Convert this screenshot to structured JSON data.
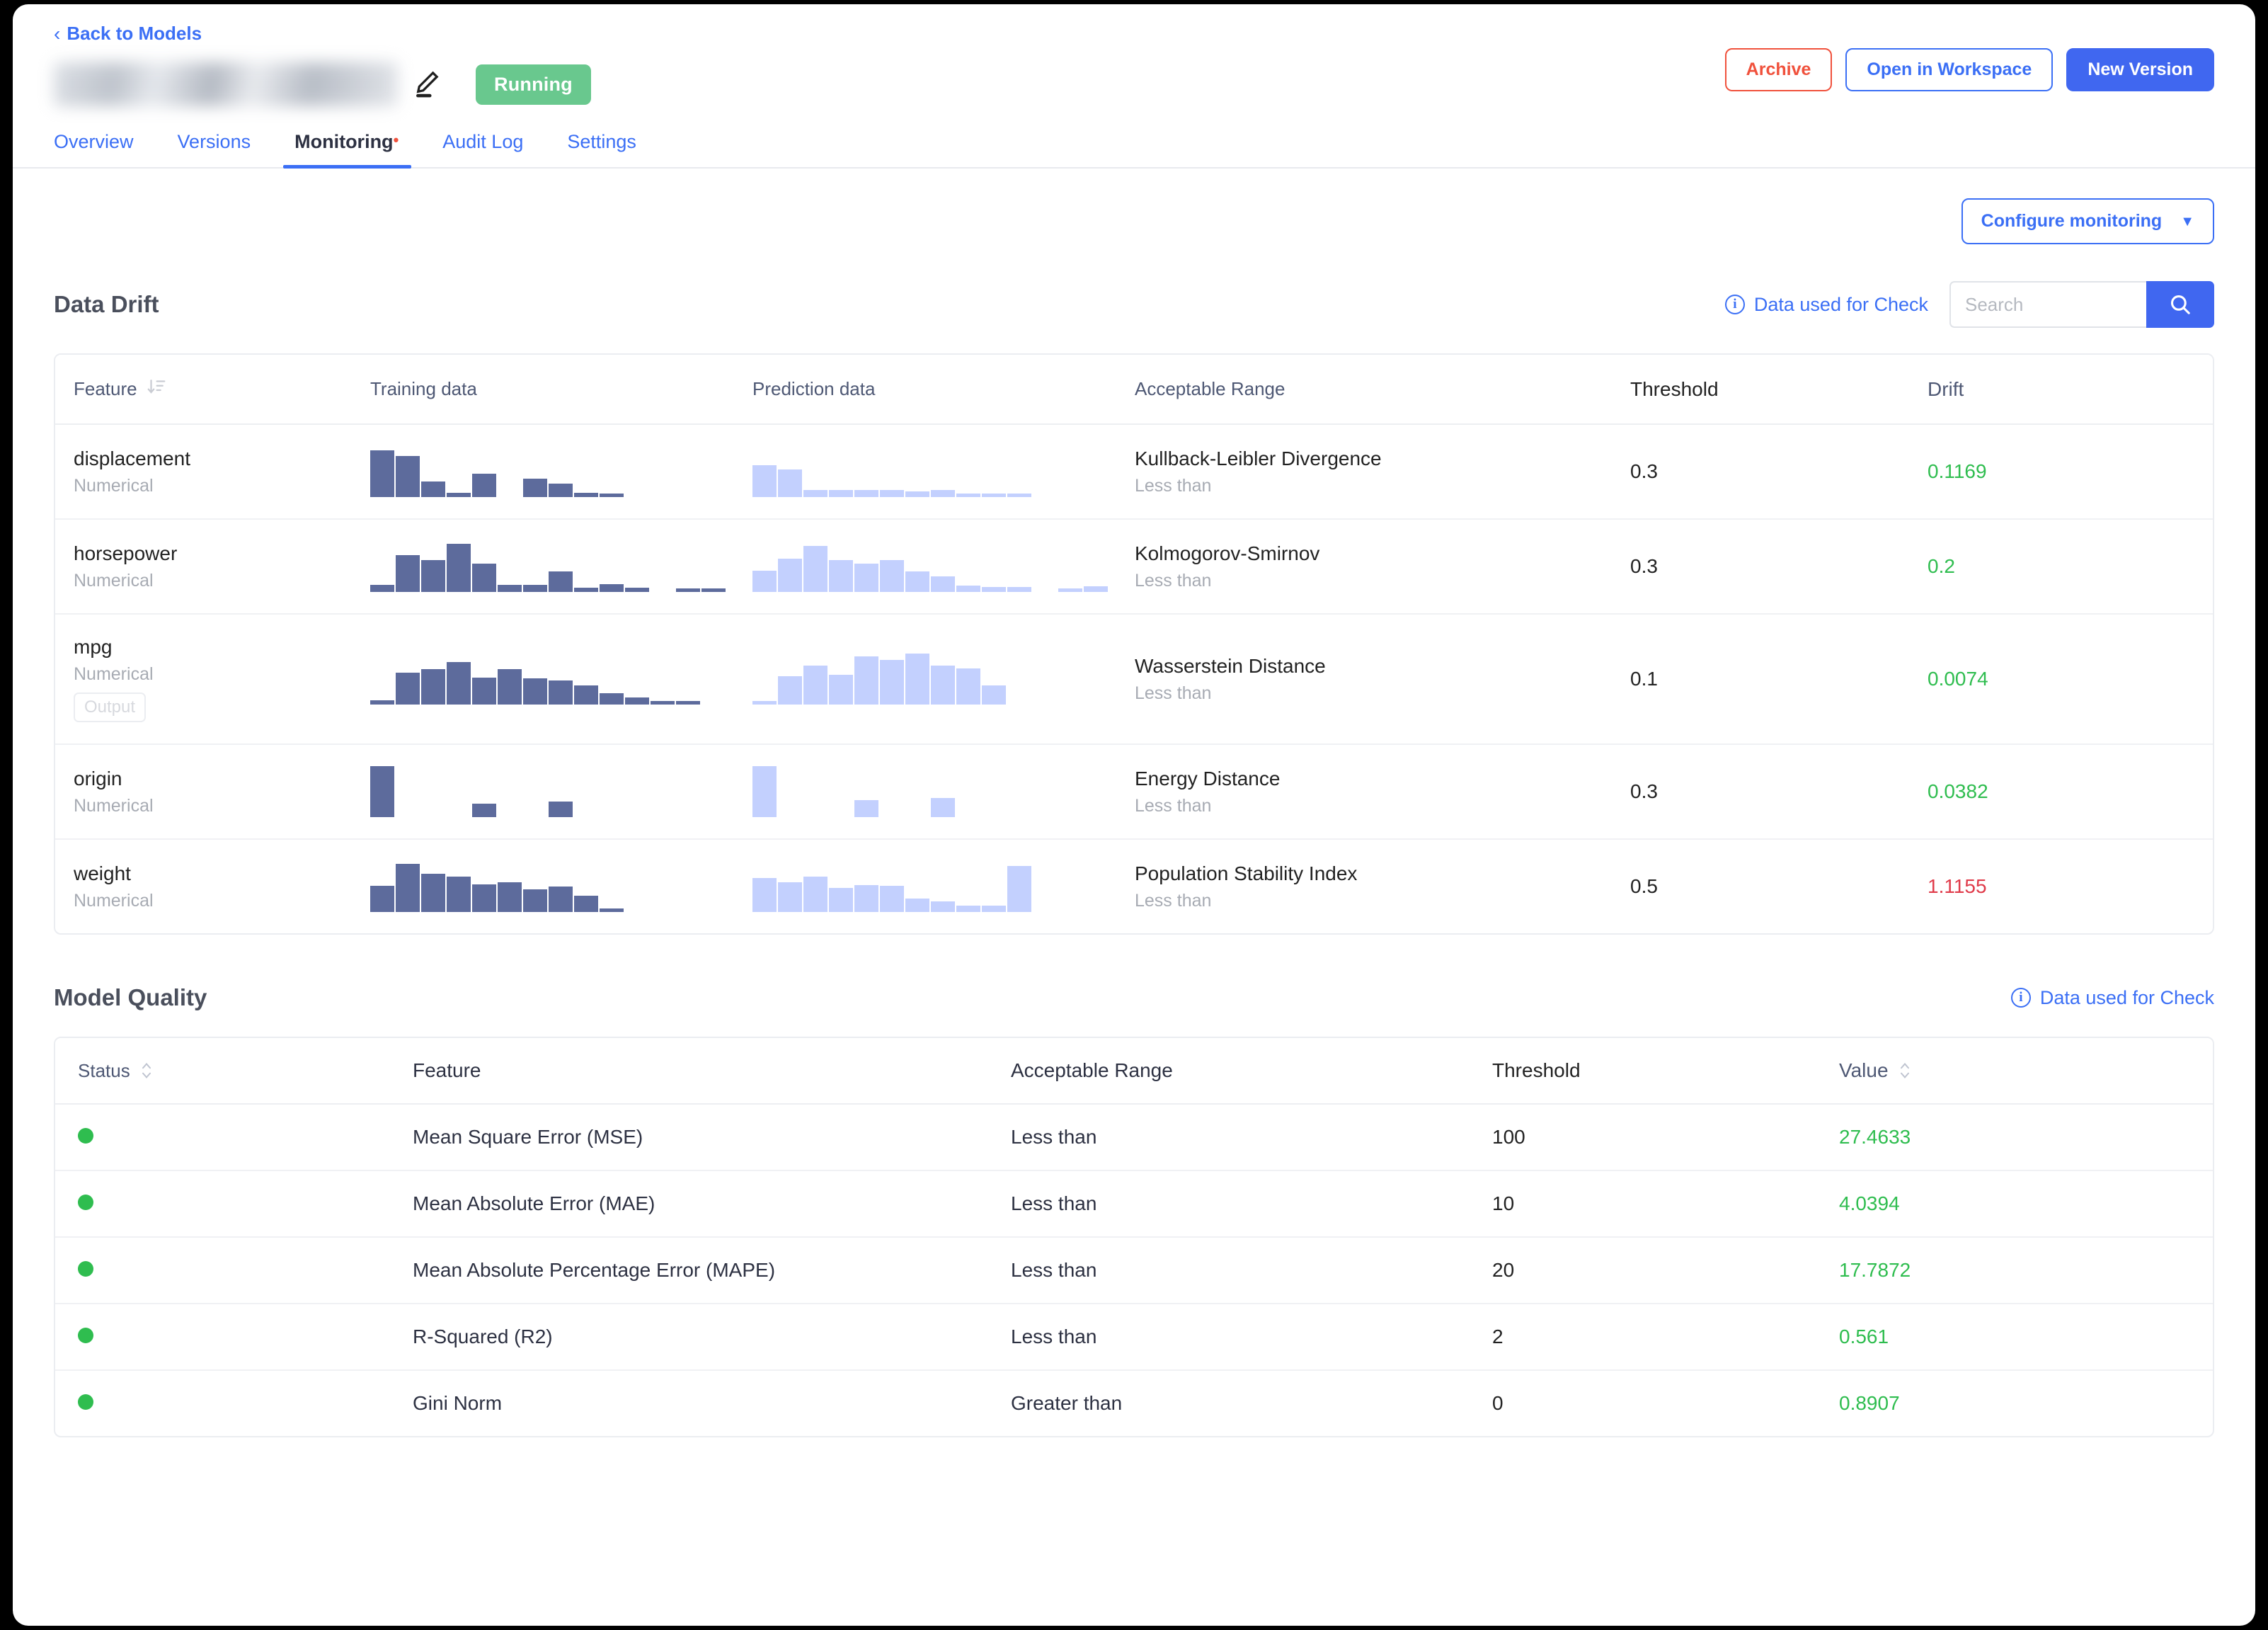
{
  "header": {
    "back_label": "Back to Models",
    "back_icon": "chevron-left-icon",
    "edit_icon": "pencil-edit-icon",
    "status_label": "Running",
    "archive_label": "Archive",
    "open_workspace_label": "Open in Workspace",
    "new_version_label": "New Version"
  },
  "tabs": [
    {
      "label": "Overview",
      "active": false
    },
    {
      "label": "Versions",
      "active": false
    },
    {
      "label": "Monitoring",
      "active": true,
      "dot": "•"
    },
    {
      "label": "Audit Log",
      "active": false
    },
    {
      "label": "Settings",
      "active": false
    }
  ],
  "toolbar": {
    "configure_label": "Configure monitoring",
    "caret_icon": "chevron-down-icon"
  },
  "data_drift": {
    "title": "Data Drift",
    "info_link": "Data used for Check",
    "info_icon": "info-circle-icon",
    "search_placeholder": "Search",
    "search_value": "",
    "search_icon": "search-icon",
    "sort_icon": "sort-descending-icon",
    "columns": [
      "Feature",
      "Training data",
      "Prediction data",
      "Acceptable Range",
      "Threshold",
      "Drift"
    ],
    "rows": [
      {
        "feature": "displacement",
        "type": "Numerical",
        "output_badge": null,
        "metric": "Kullback-Leibler Divergence",
        "comparator": "Less than",
        "threshold": "0.3",
        "drift": "0.1169",
        "drift_state": "good"
      },
      {
        "feature": "horsepower",
        "type": "Numerical",
        "output_badge": null,
        "metric": "Kolmogorov-Smirnov",
        "comparator": "Less than",
        "threshold": "0.3",
        "drift": "0.2",
        "drift_state": "good"
      },
      {
        "feature": "mpg",
        "type": "Numerical",
        "output_badge": "Output",
        "metric": "Wasserstein Distance",
        "comparator": "Less than",
        "threshold": "0.1",
        "drift": "0.0074",
        "drift_state": "good"
      },
      {
        "feature": "origin",
        "type": "Numerical",
        "output_badge": null,
        "metric": "Energy Distance",
        "comparator": "Less than",
        "threshold": "0.3",
        "drift": "0.0382",
        "drift_state": "good"
      },
      {
        "feature": "weight",
        "type": "Numerical",
        "output_badge": null,
        "metric": "Population Stability Index",
        "comparator": "Less than",
        "threshold": "0.5",
        "drift": "1.1155",
        "drift_state": "bad"
      }
    ]
  },
  "model_quality": {
    "title": "Model Quality",
    "info_link": "Data used for Check",
    "info_icon": "info-circle-icon",
    "columns": [
      "Status",
      "Feature",
      "Acceptable Range",
      "Threshold",
      "Value"
    ],
    "rows": [
      {
        "status": "ok",
        "feature": "Mean Square Error (MSE)",
        "range": "Less than",
        "threshold": "100",
        "value": "27.4633",
        "value_state": "good"
      },
      {
        "status": "ok",
        "feature": "Mean Absolute Error (MAE)",
        "range": "Less than",
        "threshold": "10",
        "value": "4.0394",
        "value_state": "good"
      },
      {
        "status": "ok",
        "feature": "Mean Absolute Percentage Error (MAPE)",
        "range": "Less than",
        "threshold": "20",
        "value": "17.7872",
        "value_state": "good"
      },
      {
        "status": "ok",
        "feature": "R-Squared (R2)",
        "range": "Less than",
        "threshold": "2",
        "value": "0.561",
        "value_state": "good"
      },
      {
        "status": "ok",
        "feature": "Gini Norm",
        "range": "Greater than",
        "threshold": "0",
        "value": "0.8907",
        "value_state": "good"
      }
    ]
  },
  "colors": {
    "accent": "#3b6ff5",
    "primary": "#4067f0",
    "danger": "#f0513c",
    "success": "#2fbd4f",
    "error": "#e03b4a",
    "running": "#69c88e",
    "training_bar": "#5d6b9c",
    "prediction_bar": "#c3d0fe"
  },
  "chart_data": [
    {
      "id": "displacement-training",
      "type": "bar",
      "title": "Training data",
      "values": [
        0.92,
        0.8,
        0.3,
        0.09,
        0.46,
        0.0,
        0.36,
        0.26,
        0.08,
        0.03
      ],
      "gap_after": 4,
      "color": "#5d6b9c"
    },
    {
      "id": "displacement-prediction",
      "type": "bar",
      "title": "Prediction data",
      "values": [
        0.62,
        0.54,
        0.14,
        0.14,
        0.14,
        0.14,
        0.11,
        0.14,
        0.05,
        0.05,
        0.03
      ],
      "color": "#c3d0fe"
    },
    {
      "id": "horsepower-training",
      "type": "bar",
      "title": "Training data",
      "values": [
        0.14,
        0.72,
        0.62,
        0.95,
        0.56,
        0.14,
        0.14,
        0.4,
        0.09,
        0.15,
        0.09,
        0.0,
        0.06,
        0.06
      ],
      "color": "#5d6b9c"
    },
    {
      "id": "horsepower-prediction",
      "type": "bar",
      "title": "Prediction data",
      "values": [
        0.42,
        0.65,
        0.9,
        0.62,
        0.56,
        0.63,
        0.4,
        0.3,
        0.13,
        0.1,
        0.1,
        0.0,
        0.03,
        0.11
      ],
      "color": "#c3d0fe"
    },
    {
      "id": "mpg-training",
      "type": "bar",
      "title": "Training data",
      "values": [
        0.08,
        0.63,
        0.7,
        0.83,
        0.53,
        0.7,
        0.52,
        0.47,
        0.37,
        0.22,
        0.14,
        0.04,
        0.05
      ],
      "color": "#5d6b9c"
    },
    {
      "id": "mpg-prediction",
      "type": "bar",
      "title": "Prediction data",
      "values": [
        0.04,
        0.55,
        0.77,
        0.59,
        0.95,
        0.88,
        1.0,
        0.76,
        0.71,
        0.37
      ],
      "color": "#c3d0fe"
    },
    {
      "id": "origin-training",
      "type": "bar",
      "title": "Training data",
      "values": [
        1.0,
        0.0,
        0.0,
        0.0,
        0.27,
        0.0,
        0.0,
        0.31
      ],
      "color": "#5d6b9c"
    },
    {
      "id": "origin-prediction",
      "type": "bar",
      "title": "Prediction data",
      "values": [
        1.0,
        0.0,
        0.0,
        0.0,
        0.33,
        0.0,
        0.0,
        0.38
      ],
      "color": "#c3d0fe"
    },
    {
      "id": "weight-training",
      "type": "bar",
      "title": "Training data",
      "values": [
        0.52,
        0.95,
        0.75,
        0.7,
        0.54,
        0.58,
        0.45,
        0.5,
        0.32,
        0.04
      ],
      "color": "#5d6b9c"
    },
    {
      "id": "weight-prediction",
      "type": "bar",
      "title": "Prediction data",
      "values": [
        0.67,
        0.59,
        0.69,
        0.47,
        0.53,
        0.52,
        0.27,
        0.21,
        0.13,
        0.13,
        0.9
      ],
      "color": "#c3d0fe"
    }
  ]
}
